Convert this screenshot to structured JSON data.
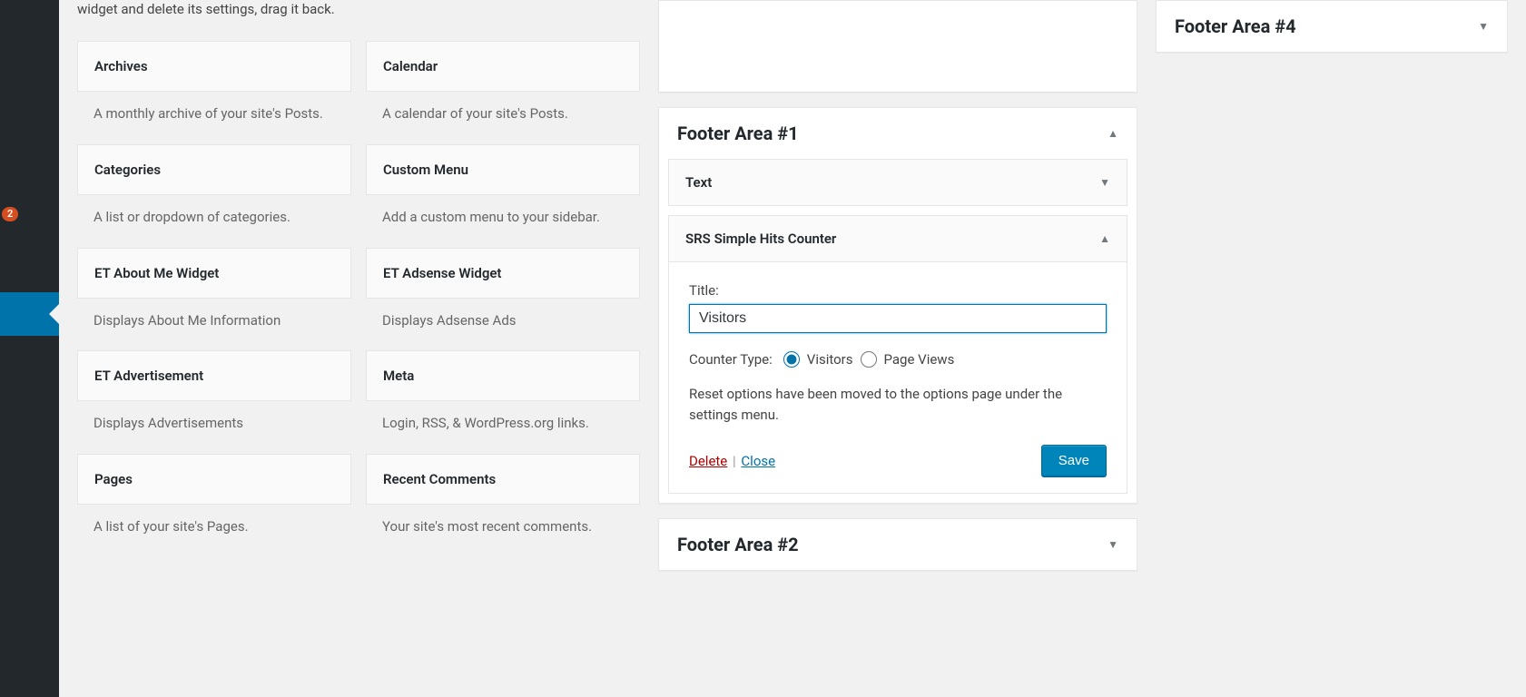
{
  "intro": "widget and delete its settings, drag it back.",
  "sidebar_badge": "2",
  "available_widgets": [
    {
      "title": "Archives",
      "desc": "A monthly archive of your site's Posts."
    },
    {
      "title": "Calendar",
      "desc": "A calendar of your site's Posts."
    },
    {
      "title": "Categories",
      "desc": "A list or dropdown of categories."
    },
    {
      "title": "Custom Menu",
      "desc": "Add a custom menu to your sidebar."
    },
    {
      "title": "ET About Me Widget",
      "desc": "Displays About Me Information"
    },
    {
      "title": "ET Adsense Widget",
      "desc": "Displays Adsense Ads"
    },
    {
      "title": "ET Advertisement",
      "desc": "Displays Advertisements"
    },
    {
      "title": "Meta",
      "desc": "Login, RSS, & WordPress.org links."
    },
    {
      "title": "Pages",
      "desc": "A list of your site's Pages."
    },
    {
      "title": "Recent Comments",
      "desc": "Your site's most recent comments."
    }
  ],
  "footer_area_1": {
    "title": "Footer Area #1",
    "text_widget": {
      "title": "Text"
    },
    "srs_widget": {
      "title": "SRS Simple Hits Counter",
      "field_label": "Title:",
      "field_value": "Visitors",
      "counter_label": "Counter Type:",
      "radio_visitors": "Visitors",
      "radio_pageviews": "Page Views",
      "note": "Reset options have been moved to the options page under the settings menu.",
      "delete": "Delete",
      "close": "Close",
      "save": "Save"
    }
  },
  "footer_area_2": {
    "title": "Footer Area #2"
  },
  "footer_area_4": {
    "title": "Footer Area #4"
  }
}
